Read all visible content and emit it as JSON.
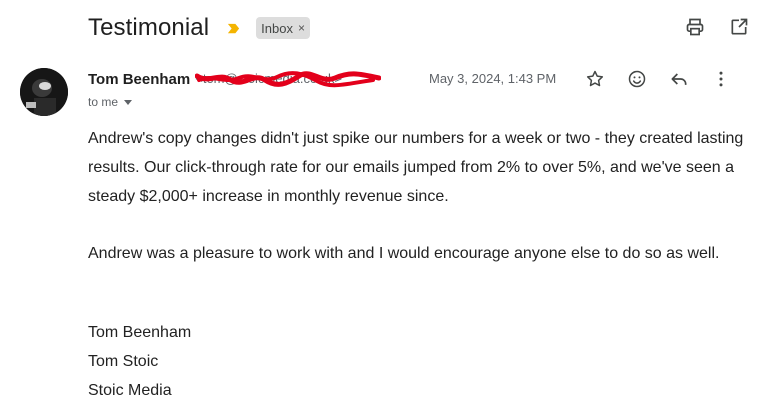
{
  "email": {
    "subject": "Testimonial",
    "label": "Inbox",
    "label_remove": "×",
    "sender_name": "Tom Beenham",
    "sender_email": "<tom@stoicmedia.co.uk>",
    "date": "May 3, 2024, 1:43 PM",
    "recipient": "to me",
    "body": [
      "Andrew's copy changes didn't just spike our numbers for a week or two - they created lasting results. Our click-through rate for our emails jumped from 2% to over 5%, and we've seen a steady $2,000+ increase in monthly revenue since.",
      "Andrew was a pleasure to work with and I would encourage anyone else to do so as well."
    ],
    "signature": [
      "Tom Beenham",
      "Tom Stoic",
      "Stoic Media"
    ]
  },
  "icons": {
    "importance": "importance-marker-icon",
    "print": "print-icon",
    "open_new_window": "open-in-new-window-icon",
    "star": "star-icon",
    "emoji": "emoji-react-icon",
    "reply": "reply-icon",
    "more": "more-vert-icon"
  },
  "colors": {
    "importance": "#f4b400",
    "redaction": "#e3001b",
    "label_bg": "#dddddd"
  }
}
